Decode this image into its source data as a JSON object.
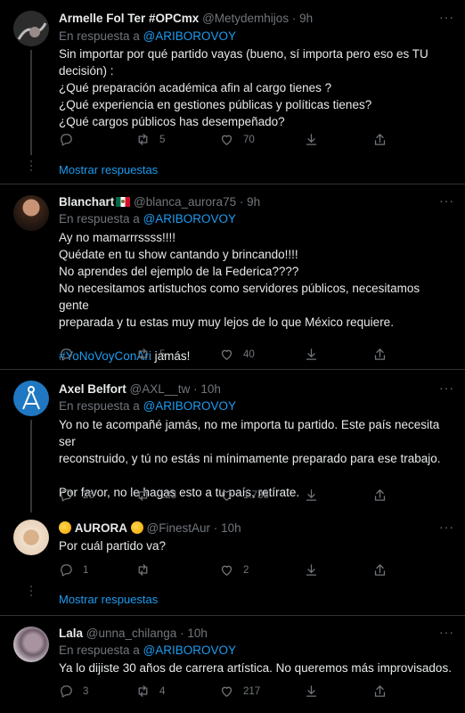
{
  "tweets": [
    {
      "name": "Armelle Fol Ter #OPCmx",
      "handle": "@Metydemhijos",
      "time": "9h",
      "reply_prefix": "En respuesta a",
      "reply_to": "@ARIBOROVOY",
      "lines": [
        "Sin importar por qué partido vayas (bueno, sí importa pero eso es TU",
        "decisión) :",
        "¿Qué preparación académica afin al cargo tienes ?",
        "¿Qué experiencia en gestiones públicas y políticas tienes?",
        "¿Qué cargos públicos has desempeñado?"
      ],
      "replies": "",
      "retweets": "5",
      "likes": "70",
      "show_more": "Mostrar respuestas"
    },
    {
      "name": "Blanchart",
      "handle": "@blanca_aurora75",
      "time": "9h",
      "reply_prefix": "En respuesta a",
      "reply_to": "@ARIBOROVOY",
      "lines": [
        "Ay no mamarrrssss!!!!",
        "Quédate en tu show cantando y brincando!!!!",
        "No aprendes del ejemplo de la Federica????",
        "No necesitamos artistuchos como servidores públicos, necesitamos gente",
        "preparada y tu estas muy muy lejos de lo que México requiere."
      ],
      "hashtag": "#YoNoVoyConAri",
      "hashtag_rest": " jamás!",
      "replies": "",
      "retweets": "5",
      "likes": "40"
    },
    {
      "name": "Axel Belfort",
      "handle": "@AXL__tw",
      "time": "10h",
      "reply_prefix": "En respuesta a",
      "reply_to": "@ARIBOROVOY",
      "lines": [
        "Yo no te acompañé jamás, no me importa tu partido. Este país necesita ser",
        "reconstruido, y tú no estás ni mínimamente preparado para ese trabajo.",
        "",
        "Por favor, no le hagas esto a tu país, retírate."
      ],
      "replies": "26",
      "retweets": "123",
      "likes": "1.736"
    },
    {
      "name": "AURORA",
      "handle": "@FinestAur",
      "time": "10h",
      "lines": [
        "Por cuál partido va?"
      ],
      "replies": "1",
      "retweets": "",
      "likes": "2",
      "show_more": "Mostrar respuestas"
    },
    {
      "name": "Lala",
      "handle": "@unna_chilanga",
      "time": "10h",
      "reply_prefix": "En respuesta a",
      "reply_to": "@ARIBOROVOY",
      "lines": [
        "Ya lo dijiste 30 años de carrera artística. No queremos más improvisados."
      ],
      "replies": "3",
      "retweets": "4",
      "likes": "217"
    }
  ],
  "separator": "·",
  "more_glyph": "···",
  "colors": {
    "accent": "#1d9bf0",
    "muted": "#71767b",
    "background": "#000000",
    "text": "#e7e9ea"
  }
}
